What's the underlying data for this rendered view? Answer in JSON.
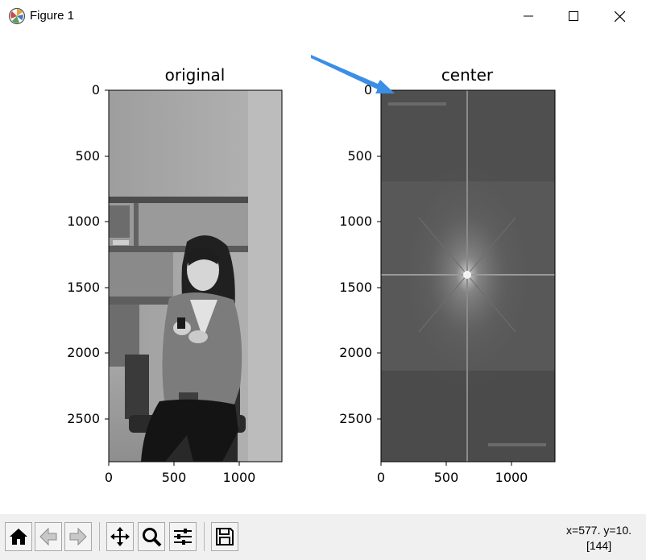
{
  "window": {
    "title": "Figure 1"
  },
  "plots": [
    {
      "title": "original",
      "yticks": [
        "0",
        "500",
        "1000",
        "1500",
        "2000",
        "2500"
      ],
      "xticks": [
        "0",
        "500",
        "1000"
      ]
    },
    {
      "title": "center",
      "yticks": [
        "0",
        "500",
        "1000",
        "1500",
        "2000",
        "2500"
      ],
      "xticks": [
        "0",
        "500",
        "1000"
      ]
    }
  ],
  "status": {
    "coords": "x=577. y=10.",
    "value": "[144]"
  },
  "annotation": {
    "arrow_color": "#3a8ee6"
  },
  "toolbar": [
    "home-icon",
    "back-arrow-icon",
    "forward-arrow-icon",
    "pan-icon",
    "zoom-icon",
    "configure-subplots-icon",
    "save-icon"
  ]
}
